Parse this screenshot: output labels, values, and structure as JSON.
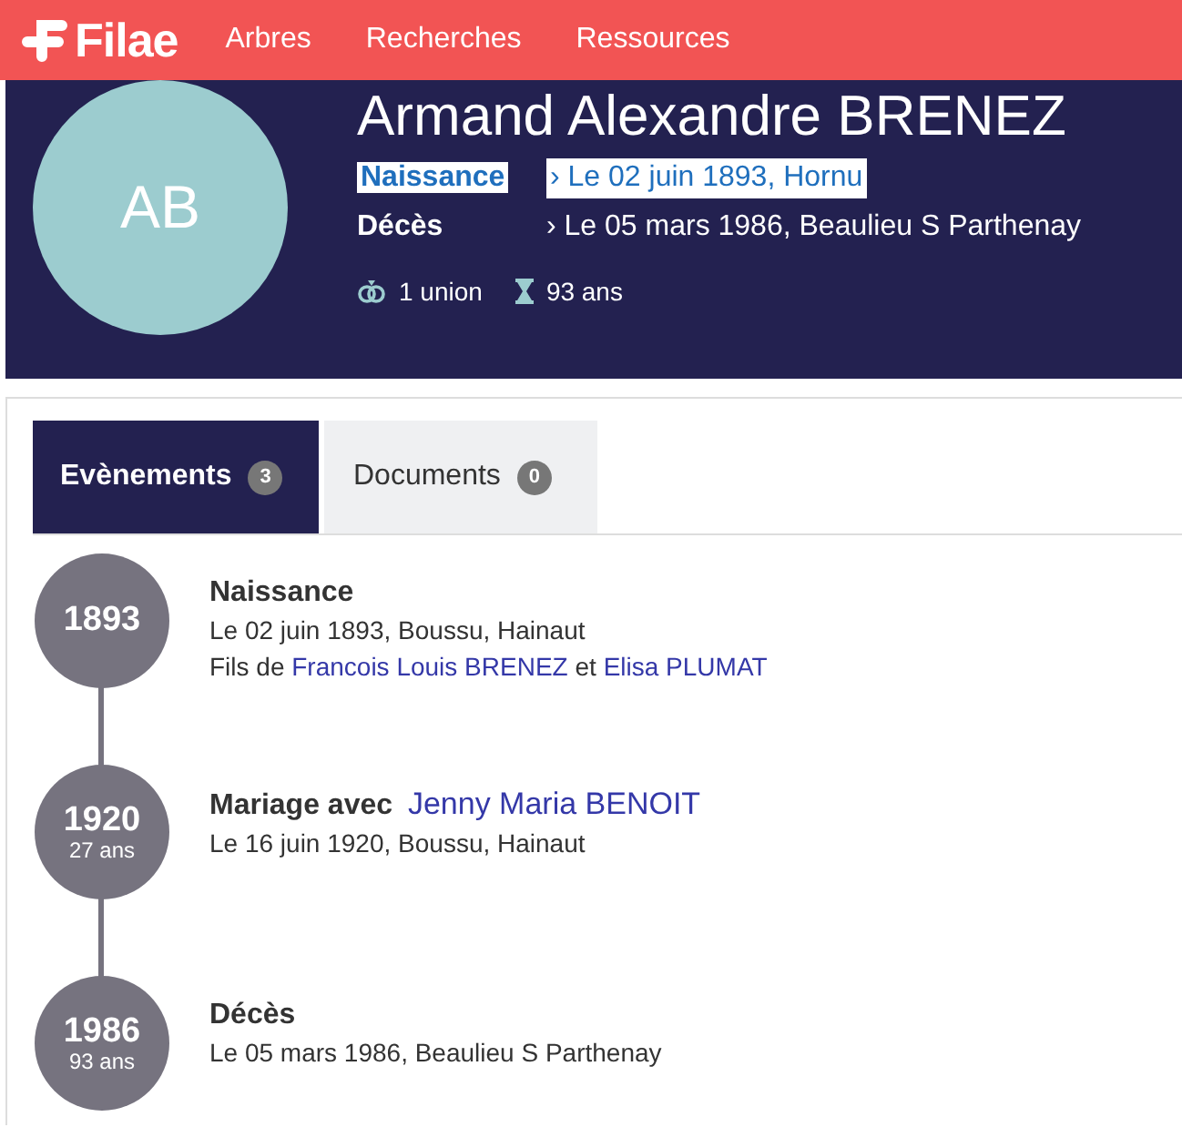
{
  "nav": {
    "logo": "Filae",
    "items": [
      "Arbres",
      "Recherches",
      "Ressources"
    ]
  },
  "person": {
    "initials": "AB",
    "name": "Armand Alexandre BRENEZ",
    "facts": [
      {
        "label": "Naissance",
        "value": "› Le 02 juin 1893, Hornu",
        "highlighted": true
      },
      {
        "label": "Décès",
        "value": "› Le 05 mars 1986, Beaulieu S Parthenay",
        "highlighted": false
      }
    ],
    "stats": [
      {
        "kind": "rings",
        "text": "1 union"
      },
      {
        "kind": "hourglass",
        "text": "93 ans"
      }
    ]
  },
  "tabs": [
    {
      "label": "Evènements",
      "count": "3",
      "selected": true
    },
    {
      "label": "Documents",
      "count": "0",
      "selected": false
    }
  ],
  "events": [
    {
      "year": "1893",
      "title": [
        {
          "text": "Naissance",
          "link": false
        }
      ],
      "lines": [
        [
          {
            "text": "Le 02 juin 1893, Boussu, Hainaut",
            "link": false
          }
        ],
        [
          {
            "text": "Fils de ",
            "link": false
          },
          {
            "text": "Francois Louis BRENEZ",
            "link": true
          },
          {
            "text": " et ",
            "link": false
          },
          {
            "text": "Elisa PLUMAT",
            "link": true
          }
        ]
      ]
    },
    {
      "year": "1920",
      "age": "27 ans",
      "title": [
        {
          "text": "Mariage avec ",
          "link": false
        },
        {
          "text": "Jenny Maria BENOIT",
          "link": true
        }
      ],
      "lines": [
        [
          {
            "text": "Le 16 juin 1920, Boussu, Hainaut",
            "link": false
          }
        ]
      ]
    },
    {
      "year": "1986",
      "age": "93 ans",
      "title": [
        {
          "text": "Décès",
          "link": false
        }
      ],
      "lines": [
        [
          {
            "text": "Le 05 mars 1986, Beaulieu S Parthenay",
            "link": false
          }
        ]
      ]
    }
  ]
}
